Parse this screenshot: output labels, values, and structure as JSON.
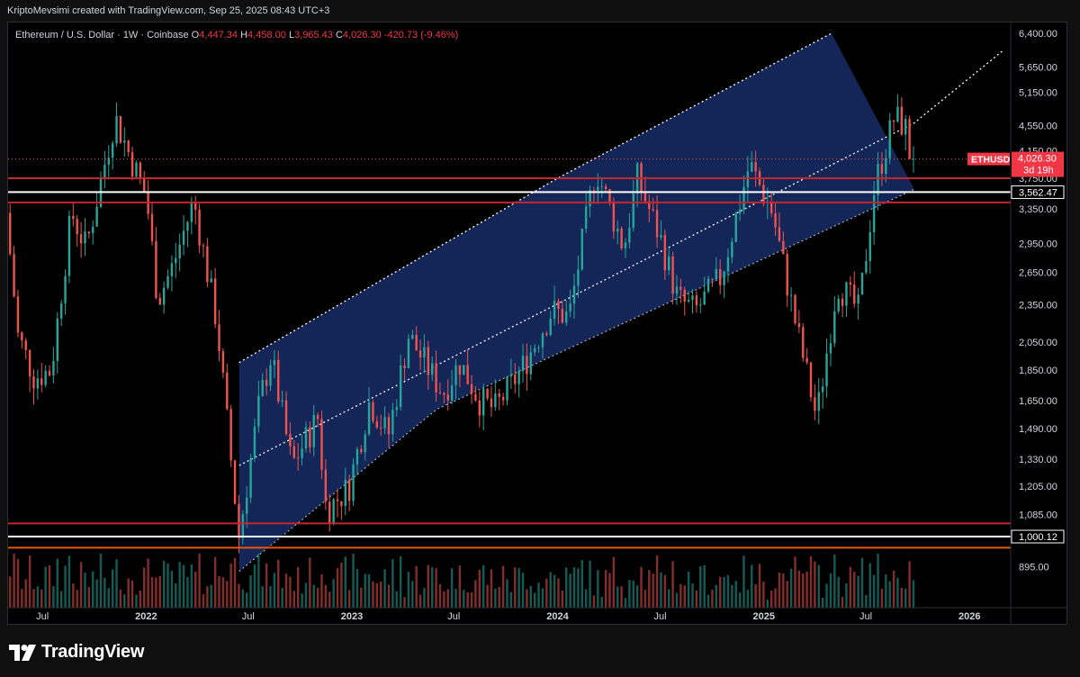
{
  "header": {
    "attribution": "KriptoMevsimi created with TradingView.com, Sep 25, 2025 08:43 UTC+3"
  },
  "legend": {
    "symbol": "Ethereum / U.S. Dollar · 1W · Coinbase",
    "open_label": "O",
    "open": "4,447.34",
    "high_label": "H",
    "high": "4,458.00",
    "low_label": "L",
    "low": "3,965.43",
    "close_label": "C",
    "close": "4,026.30",
    "change": "-420.73 (-9.46%)"
  },
  "price_tag": {
    "symbol": "ETHUSD",
    "price": "4,026.30",
    "countdown": "3d 19h"
  },
  "footer": {
    "brand": "TradingView"
  },
  "colors": {
    "up": "#26a69a",
    "down": "#ef5350",
    "channel_fill": "#182c66",
    "hline_red": "#c2272d",
    "hline_white": "#ffffff",
    "hline_orange": "#e8590c",
    "background": "#000000"
  },
  "chart_data": {
    "type": "candlestick",
    "title": "Ethereum / U.S. Dollar · 1W · Coinbase",
    "y_scale": "log",
    "ylim": [
      850,
      6400
    ],
    "xlim": [
      "2021-05-01",
      "2026-03-15"
    ],
    "y_ticks": [
      "6,400.00",
      "5,650.00",
      "5,150.00",
      "4,550.00",
      "4,150.00",
      "3,750.00",
      "3,350.00",
      "2,950.00",
      "2,650.00",
      "2,350.00",
      "2,050.00",
      "1,850.00",
      "1,650.00",
      "1,490.00",
      "1,330.00",
      "1,205.00",
      "1,085.00",
      "895.00"
    ],
    "x_ticks": [
      {
        "label": "Jul",
        "date": "2021-07-01",
        "bold": false
      },
      {
        "label": "2022",
        "date": "2022-01-01",
        "bold": true
      },
      {
        "label": "Jul",
        "date": "2022-07-01",
        "bold": false
      },
      {
        "label": "2023",
        "date": "2023-01-01",
        "bold": true
      },
      {
        "label": "Jul",
        "date": "2023-07-01",
        "bold": false
      },
      {
        "label": "2024",
        "date": "2024-01-01",
        "bold": true
      },
      {
        "label": "Jul",
        "date": "2024-07-01",
        "bold": false
      },
      {
        "label": "2025",
        "date": "2025-01-01",
        "bold": true
      },
      {
        "label": "Jul",
        "date": "2025-07-01",
        "bold": false
      },
      {
        "label": "2026",
        "date": "2026-01-01",
        "bold": true
      }
    ],
    "price_levels": [
      {
        "price": 3750,
        "color": "red",
        "label": ""
      },
      {
        "price": 3562.47,
        "color": "white",
        "label": "3,562.47"
      },
      {
        "price": 3430,
        "color": "red",
        "label": ""
      },
      {
        "price": 1050,
        "color": "red",
        "label": ""
      },
      {
        "price": 1000.12,
        "color": "white",
        "label": "1,000.12"
      },
      {
        "price": 960,
        "color": "orange",
        "label": ""
      }
    ],
    "current_price": 4026.3,
    "channel": {
      "upper": [
        [
          "2022-06-15",
          1900
        ],
        [
          "2024-01-01",
          3750
        ],
        [
          "2025-05-01",
          6400
        ]
      ],
      "lower": [
        [
          "2022-06-15",
          880
        ],
        [
          "2023-06-01",
          1600
        ],
        [
          "2025-09-25",
          3600
        ]
      ],
      "mid": [
        [
          "2022-06-15",
          1300
        ],
        [
          "2025-09-25",
          4600
        ],
        [
          "2026-03-01",
          6000
        ]
      ]
    },
    "anchors": [
      [
        "2021-05-01",
        3300
      ],
      [
        "2021-05-22",
        2100
      ],
      [
        "2021-06-20",
        1800
      ],
      [
        "2021-07-20",
        1850
      ],
      [
        "2021-08-25",
        3300
      ],
      [
        "2021-09-20",
        2900
      ],
      [
        "2021-11-10",
        4700
      ],
      [
        "2021-12-10",
        4000
      ],
      [
        "2022-01-05",
        3500
      ],
      [
        "2022-01-25",
        2400
      ],
      [
        "2022-02-20",
        2700
      ],
      [
        "2022-03-30",
        3450
      ],
      [
        "2022-05-10",
        2200
      ],
      [
        "2022-06-18",
        1000
      ],
      [
        "2022-07-25",
        1650
      ],
      [
        "2022-08-14",
        1950
      ],
      [
        "2022-09-20",
        1300
      ],
      [
        "2022-11-05",
        1550
      ],
      [
        "2022-11-20",
        1100
      ],
      [
        "2022-12-30",
        1200
      ],
      [
        "2023-02-05",
        1650
      ],
      [
        "2023-03-10",
        1450
      ],
      [
        "2023-04-15",
        2100
      ],
      [
        "2023-06-15",
        1700
      ],
      [
        "2023-07-15",
        1900
      ],
      [
        "2023-08-20",
        1650
      ],
      [
        "2023-09-15",
        1600
      ],
      [
        "2023-11-01",
        1850
      ],
      [
        "2023-12-25",
        2300
      ],
      [
        "2024-01-25",
        2250
      ],
      [
        "2024-03-12",
        3900
      ],
      [
        "2024-05-01",
        2900
      ],
      [
        "2024-05-25",
        3750
      ],
      [
        "2024-07-05",
        3000
      ],
      [
        "2024-08-05",
        2400
      ],
      [
        "2024-09-05",
        2300
      ],
      [
        "2024-10-20",
        2600
      ],
      [
        "2024-12-10",
        3950
      ],
      [
        "2025-01-20",
        3300
      ],
      [
        "2025-02-25",
        2300
      ],
      [
        "2025-04-08",
        1550
      ],
      [
        "2025-05-15",
        2550
      ],
      [
        "2025-06-22",
        2300
      ],
      [
        "2025-07-20",
        3650
      ],
      [
        "2025-08-24",
        4700
      ],
      [
        "2025-09-12",
        4550
      ],
      [
        "2025-09-22",
        4026
      ]
    ],
    "volume_note": "volume histogram in lower pane, bars colored by candle direction"
  }
}
